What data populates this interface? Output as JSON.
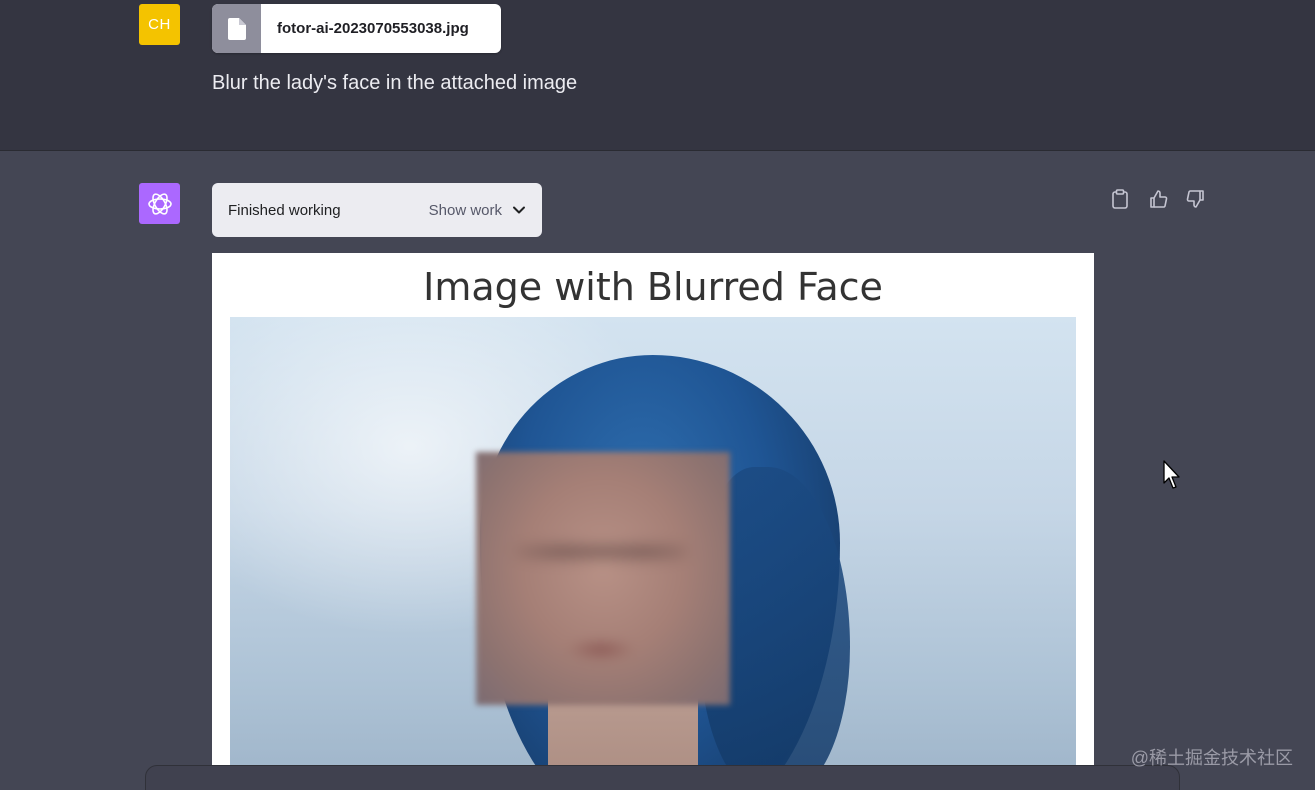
{
  "user_message": {
    "avatar_initials": "CH",
    "avatar_color": "#f4c300",
    "attachment": {
      "icon": "file-icon",
      "filename": "fotor-ai-2023070553038.jpg"
    },
    "text": "Blur the lady's face in the attached image"
  },
  "assistant_message": {
    "avatar_icon": "openai-logo-icon",
    "avatar_color": "#ab68ff",
    "status": {
      "label": "Finished working",
      "toggle_label": "Show work",
      "toggle_icon": "chevron-down-icon"
    },
    "actions": [
      {
        "icon": "clipboard-icon"
      },
      {
        "icon": "thumbs-up-icon"
      },
      {
        "icon": "thumbs-down-icon"
      }
    ],
    "result_image": {
      "title": "Image with Blurred Face"
    }
  },
  "watermark": "@稀土掘金技术社区",
  "colors": {
    "user_bg": "#343541",
    "assistant_bg": "#444654",
    "status_pill_bg": "#ececf1"
  }
}
